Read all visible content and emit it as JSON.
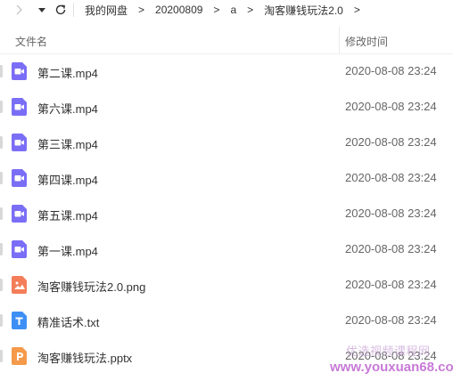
{
  "toolbar": {
    "breadcrumbs": [
      "我的网盘",
      "20200809",
      "a",
      "淘客赚钱玩法2.0"
    ],
    "separator": ">",
    "trailing_separator": ">"
  },
  "columns": {
    "name": "文件名",
    "modified": "修改时间"
  },
  "files": [
    {
      "name": "第二课.mp4",
      "modified": "2020-08-08 23:24",
      "icon": "video-icon",
      "color": "#7b6ef6"
    },
    {
      "name": "第六课.mp4",
      "modified": "2020-08-08 23:24",
      "icon": "video-icon",
      "color": "#7b6ef6"
    },
    {
      "name": "第三课.mp4",
      "modified": "2020-08-08 23:24",
      "icon": "video-icon",
      "color": "#7b6ef6"
    },
    {
      "name": "第四课.mp4",
      "modified": "2020-08-08 23:24",
      "icon": "video-icon",
      "color": "#7b6ef6"
    },
    {
      "name": "第五课.mp4",
      "modified": "2020-08-08 23:24",
      "icon": "video-icon",
      "color": "#7b6ef6"
    },
    {
      "name": "第一课.mp4",
      "modified": "2020-08-08 23:24",
      "icon": "video-icon",
      "color": "#7b6ef6"
    },
    {
      "name": "淘客赚钱玩法2.0.png",
      "modified": "2020-08-08 23:24",
      "icon": "image-icon",
      "color": "#f47d5a"
    },
    {
      "name": "精准话术.txt",
      "modified": "2020-08-08 23:24",
      "icon": "text-icon",
      "color": "#3d8ff5"
    },
    {
      "name": "淘客赚钱玩法.pptx",
      "modified": "2020-08-08 23:24",
      "icon": "ppt-icon",
      "color": "#f59a4a"
    }
  ],
  "watermark": {
    "line1": "优选视频课程网",
    "line2": "www.youxuan68.com"
  }
}
